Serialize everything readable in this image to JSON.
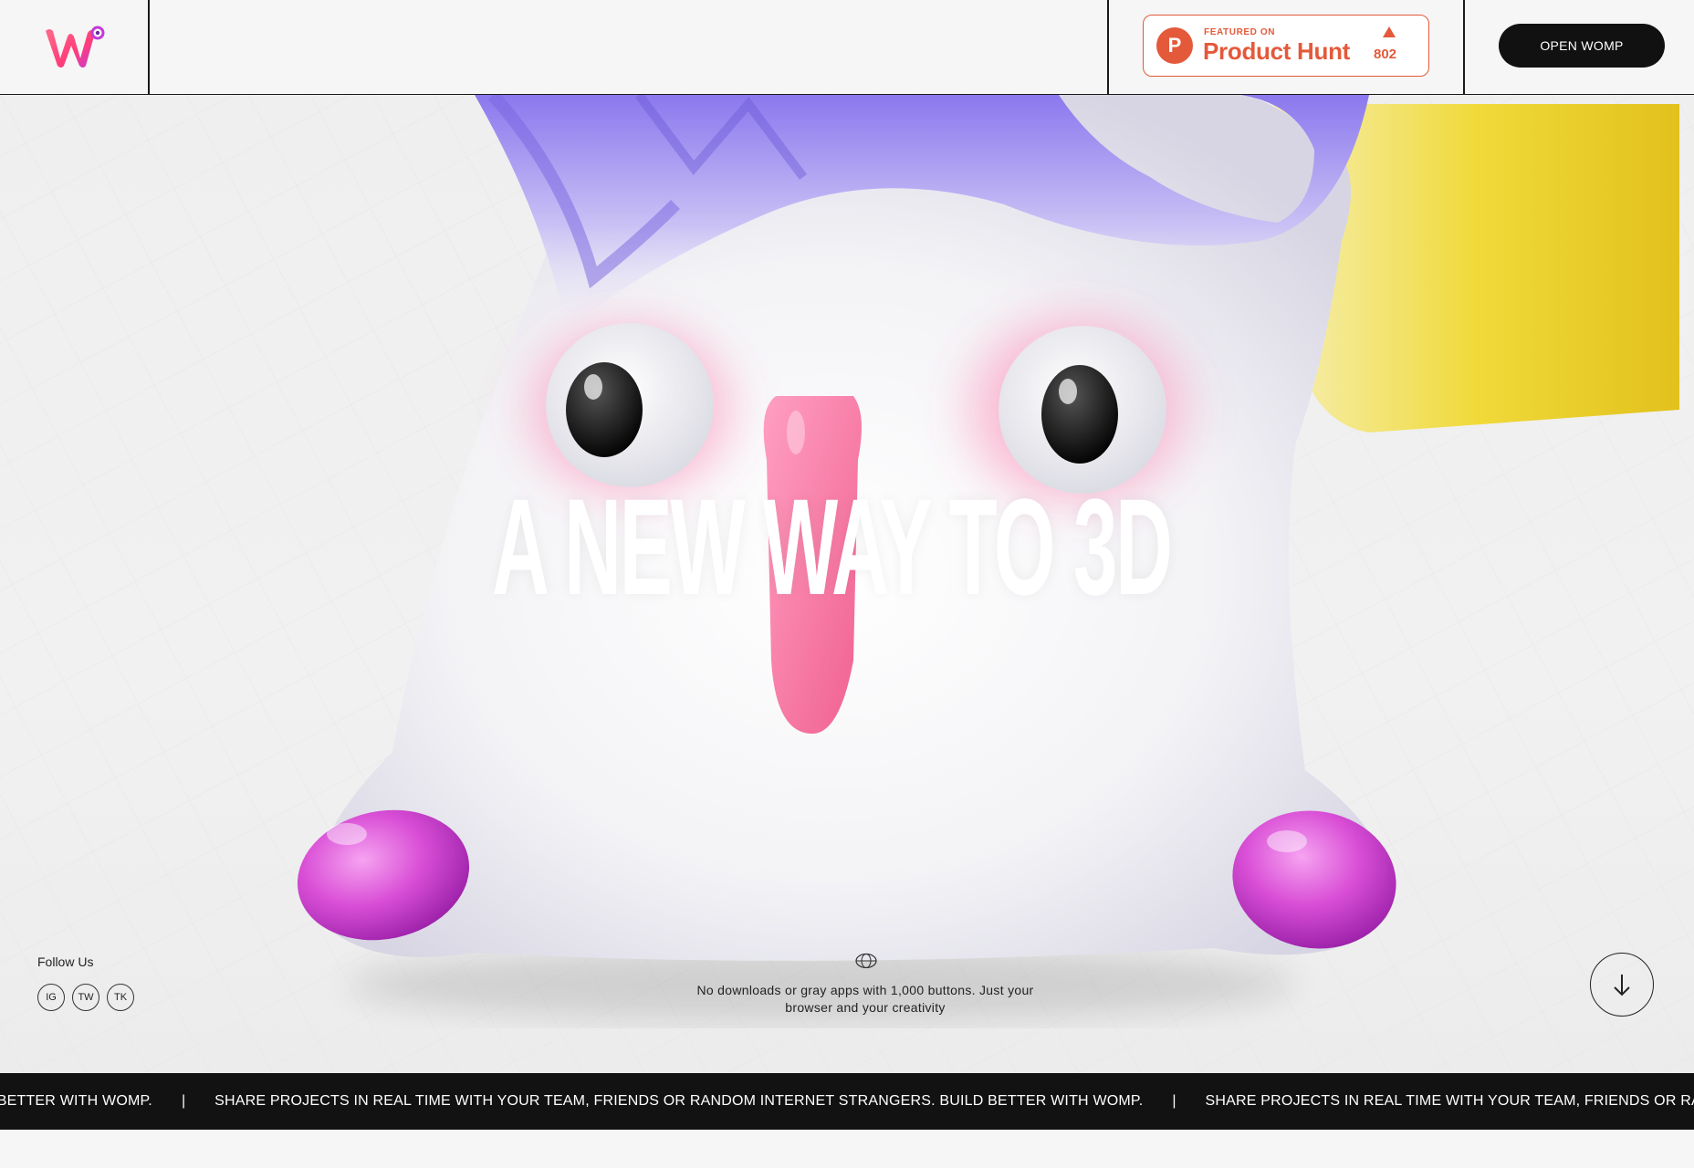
{
  "header": {
    "product_hunt": {
      "featured_label": "FEATURED ON",
      "name": "Product Hunt",
      "letter": "P",
      "votes": "802"
    },
    "open_button": "OPEN WOMP"
  },
  "hero": {
    "headline": "A NEW WAY TO 3D",
    "follow_label": "Follow Us",
    "social": [
      "IG",
      "TW",
      "TK"
    ],
    "tagline": "No downloads or gray apps with 1,000 buttons. Just your browser and your creativity"
  },
  "ticker": {
    "items": [
      "NTERNET STRANGERS. BUILD BETTER WITH WOMP.",
      "SHARE PROJECTS IN REAL TIME WITH YOUR TEAM, FRIENDS OR RANDOM INTERNET STRANGERS. BUILD BETTER WITH WOMP.",
      "SHARE PROJECTS IN REAL TIME WITH YOUR TEAM, FRIENDS OR RANDOM"
    ],
    "separator": "|"
  },
  "colors": {
    "product_hunt": "#e4593a",
    "button_bg": "#111111",
    "creature_pink": "#f47aa6",
    "creature_magenta": "#d94fd6",
    "block_yellow": "#e8c81f"
  }
}
